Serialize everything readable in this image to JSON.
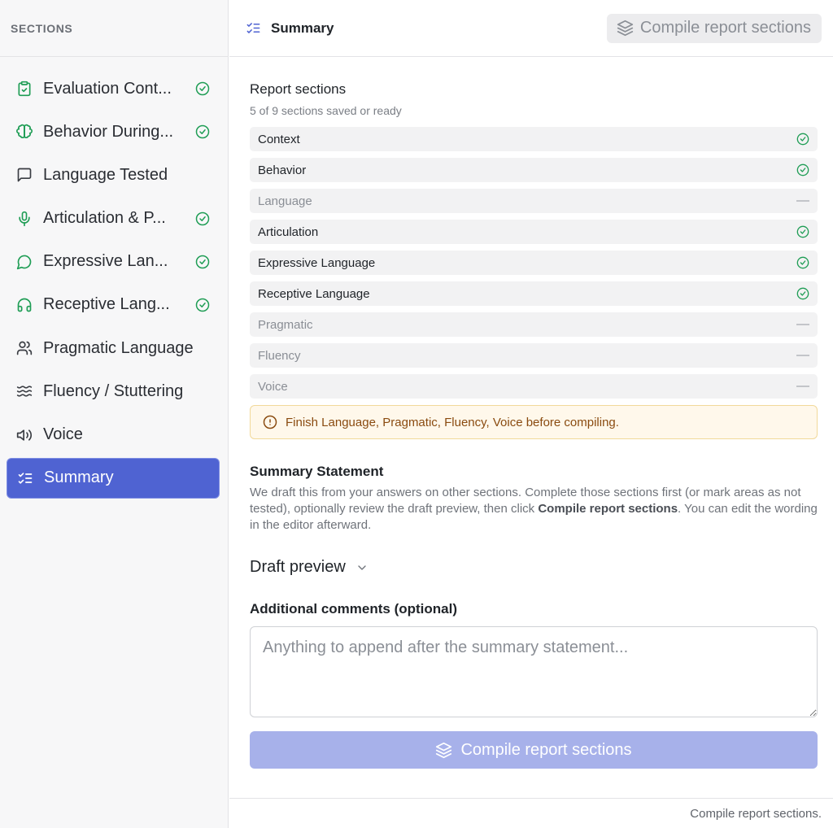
{
  "sidebar": {
    "header": "SECTIONS",
    "items": [
      {
        "label": "Evaluation Cont...",
        "icon": "clipboard-check-icon",
        "done": true
      },
      {
        "label": "Behavior During...",
        "icon": "brain-icon",
        "done": true
      },
      {
        "label": "Language Tested",
        "icon": "message-square-icon",
        "done": false
      },
      {
        "label": "Articulation & P...",
        "icon": "microphone-icon",
        "done": true
      },
      {
        "label": "Expressive Lan...",
        "icon": "message-circle-icon",
        "done": true
      },
      {
        "label": "Receptive Lang...",
        "icon": "headphones-icon",
        "done": true
      },
      {
        "label": "Pragmatic Language",
        "icon": "users-icon",
        "done": false
      },
      {
        "label": "Fluency / Stuttering",
        "icon": "waves-icon",
        "done": false
      },
      {
        "label": "Voice",
        "icon": "speaker-icon",
        "done": false
      },
      {
        "label": "Summary",
        "icon": "list-checks-icon",
        "done": false,
        "active": true
      }
    ]
  },
  "header": {
    "title": "Summary",
    "compile_label": "Compile report sections"
  },
  "report": {
    "heading": "Report sections",
    "subtitle": "5 of 9 sections saved or ready",
    "rows": [
      {
        "label": "Context",
        "done": true
      },
      {
        "label": "Behavior",
        "done": true
      },
      {
        "label": "Language",
        "done": false
      },
      {
        "label": "Articulation",
        "done": true
      },
      {
        "label": "Expressive Language",
        "done": true
      },
      {
        "label": "Receptive Language",
        "done": true
      },
      {
        "label": "Pragmatic",
        "done": false
      },
      {
        "label": "Fluency",
        "done": false
      },
      {
        "label": "Voice",
        "done": false
      }
    ],
    "warning": "Finish Language, Pragmatic, Fluency, Voice before compiling."
  },
  "summary": {
    "heading": "Summary Statement",
    "desc_before": "We draft this from your answers on other sections. Complete those sections first (or mark areas as not tested), optionally review the draft preview, then click ",
    "desc_bold": "Compile report sections",
    "desc_after": ". You can edit the wording in the editor afterward.",
    "draft_label": "Draft preview",
    "comments_label": "Additional comments (optional)",
    "comments_placeholder": "Anything to append after the summary statement...",
    "comments_value": "",
    "compile_label": "Compile report sections"
  },
  "footer": {
    "text": "Compile report sections."
  },
  "colors": {
    "accent": "#4f63d2",
    "success": "#1f9d55",
    "warning_bg": "#fff8eb",
    "warning_text": "#8a4b10"
  }
}
